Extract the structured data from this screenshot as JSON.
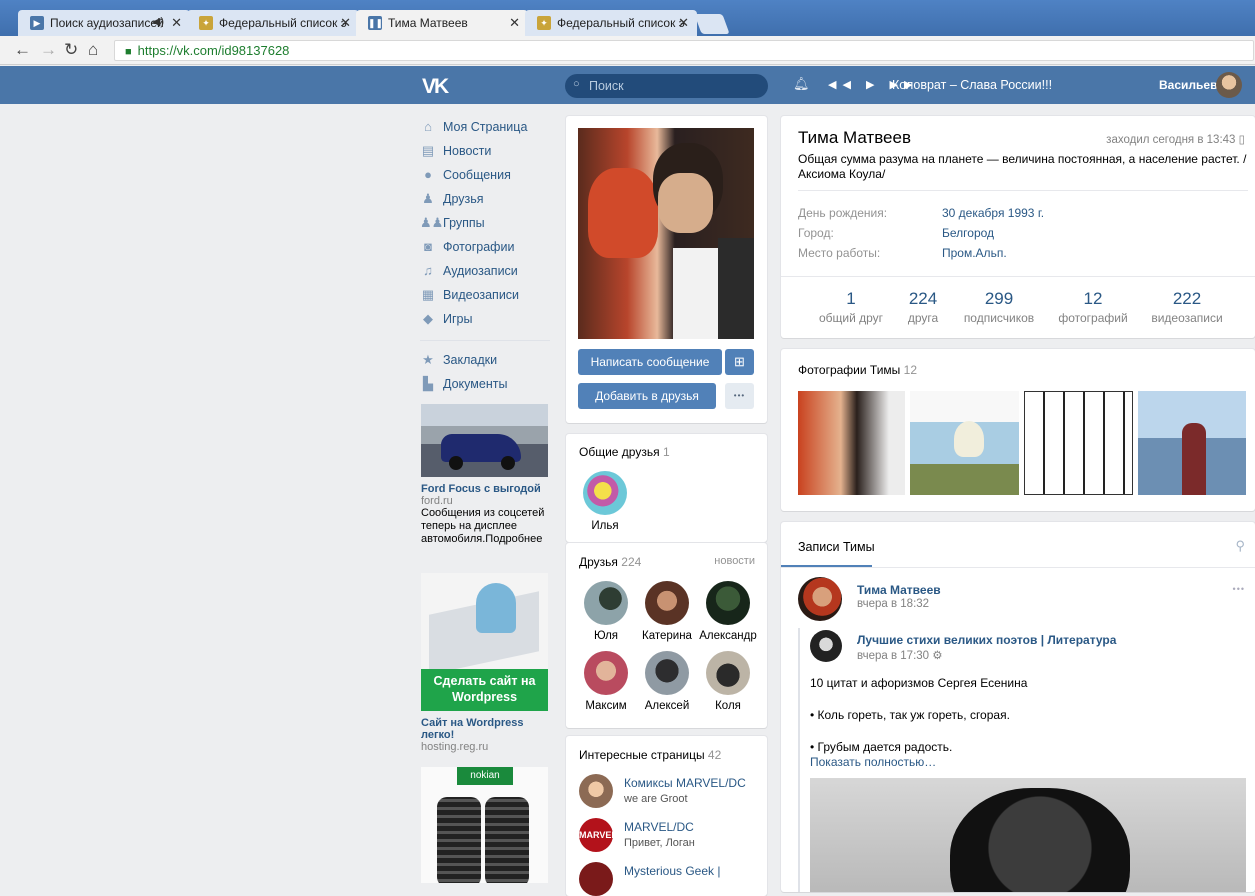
{
  "browser": {
    "tabs": [
      {
        "title": "Поиск аудиозаписей",
        "sound": "◀)",
        "close": "✕"
      },
      {
        "title": "Федеральный список э",
        "close": "✕"
      },
      {
        "title": "Тима Матвеев",
        "close": "✕"
      },
      {
        "title": "Федеральный список э",
        "close": "✕"
      }
    ],
    "url": "https://vk.com/id98137628"
  },
  "header": {
    "logo": "VK",
    "search_placeholder": "Поиск",
    "track": "Коловрат – Слава России!!!",
    "user_name": "Васильев"
  },
  "menu": {
    "items": [
      {
        "label": "Моя Страница",
        "icon": "home-icon"
      },
      {
        "label": "Новости",
        "icon": "news-icon"
      },
      {
        "label": "Сообщения",
        "icon": "messages-icon"
      },
      {
        "label": "Друзья",
        "icon": "friend-icon"
      },
      {
        "label": "Группы",
        "icon": "groups-icon"
      },
      {
        "label": "Фотографии",
        "icon": "camera-icon"
      },
      {
        "label": "Аудиозаписи",
        "icon": "music-icon"
      },
      {
        "label": "Видеозаписи",
        "icon": "film-icon"
      },
      {
        "label": "Игры",
        "icon": "gamepad-icon"
      }
    ],
    "extra": [
      {
        "label": "Закладки",
        "icon": "star-icon"
      },
      {
        "label": "Документы",
        "icon": "document-icon"
      }
    ]
  },
  "ads": [
    {
      "title": "Ford Focus с выгодой",
      "site": "ford.ru",
      "text": "Сообщения из соцсетей теперь на дисплее автомобиля.Подробнее"
    },
    {
      "banner": "Сделать сайт на Wordpress",
      "title": "Сайт на Wordpress легко!",
      "site": "hosting.reg.ru"
    },
    {
      "brand": "nokian"
    }
  ],
  "profile": {
    "send_message": "Написать сообщение",
    "add_friend": "Добавить в друзья",
    "more": "•••",
    "gift": "gift-icon"
  },
  "common_friends": {
    "title": "Общие друзья",
    "count": "1",
    "name": "Илья"
  },
  "friends": {
    "title": "Друзья",
    "count": "224",
    "updates": "новости",
    "names": [
      "Юля",
      "Катерина",
      "Александр",
      "Максим",
      "Алексей",
      "Коля"
    ]
  },
  "pages": {
    "title": "Интересные страницы",
    "count": "42",
    "items": [
      {
        "name": "Комиксы MARVEL/DC",
        "sub": "we are Groot"
      },
      {
        "name": "MARVEL/DC",
        "sub": "Привет, Логан"
      },
      {
        "name": "Mysterious Geek |",
        "sub": ""
      }
    ]
  },
  "info": {
    "name": "Тима Матвеев",
    "online": "заходил сегодня в 13:43",
    "status": "Общая сумма разума на планете — величина постоянная, а население растет. / Аксиома Коула/",
    "rows": [
      {
        "label": "День рождения:",
        "value": "30 декабря 1993 г."
      },
      {
        "label": "Город:",
        "value": "Белгород"
      },
      {
        "label": "Место работы:",
        "value": "Пром.Альп."
      }
    ],
    "stats": [
      {
        "num": "1",
        "label": "общий друг"
      },
      {
        "num": "224",
        "label": "друга"
      },
      {
        "num": "299",
        "label": "подписчиков"
      },
      {
        "num": "12",
        "label": "фотографий"
      },
      {
        "num": "222",
        "label": "видеозаписи"
      }
    ]
  },
  "photos": {
    "title": "Фотографии Тимы",
    "count": "12"
  },
  "wall": {
    "title": "Записи Тимы",
    "author": "Тима Матвеев",
    "time": "вчера в 18:32",
    "repost_author": "Лучшие стихи великих поэтов | Литература",
    "repost_time": "вчера в 17:30",
    "text1": "10 цитат и афоризмов Сергея Есенина",
    "text2": "• Коль гореть, так уж гореть, сгорая.",
    "text3": "• Грубым дается радость.",
    "show_more": "Показать полностью…"
  },
  "colors": {
    "vk_blue": "#4a76a8",
    "button": "#5181b8",
    "link": "#2a5885"
  }
}
